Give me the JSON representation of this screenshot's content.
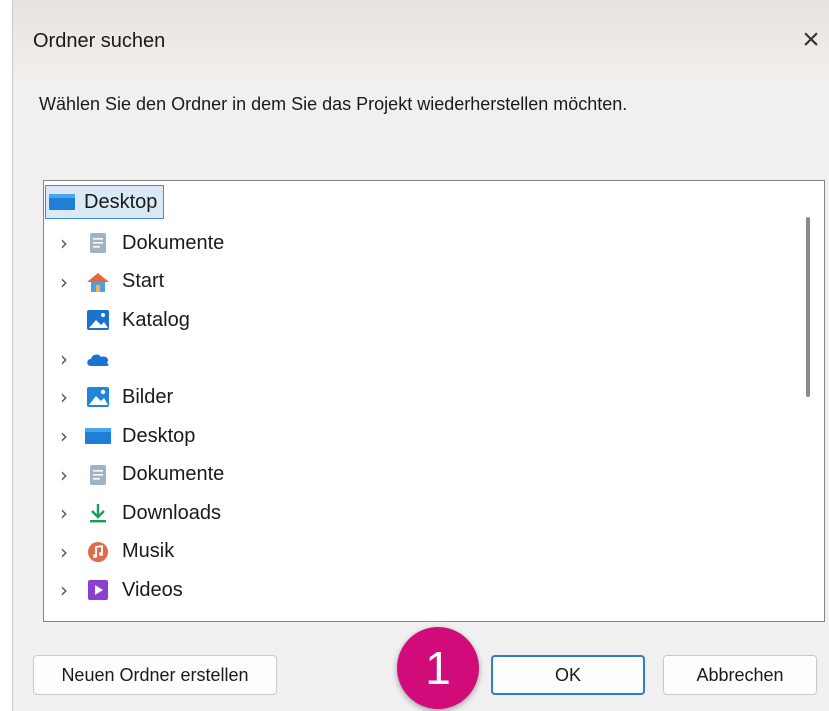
{
  "dialog": {
    "title": "Ordner suchen",
    "close_symbol": "×",
    "prompt": "Wählen Sie den Ordner in dem Sie das Projekt wiederherstellen möchten."
  },
  "tree": {
    "root": {
      "label": "Desktop",
      "icon": "desktop-folder-icon",
      "selected": true
    },
    "items": [
      {
        "label": "Dokumente",
        "icon": "documents-icon",
        "expandable": true
      },
      {
        "label": "Start",
        "icon": "home-icon",
        "expandable": true
      },
      {
        "label": "Katalog",
        "icon": "gallery-icon",
        "expandable": false
      },
      {
        "label": "",
        "icon": "onedrive-cloud-icon",
        "expandable": true
      },
      {
        "label": "Bilder",
        "icon": "pictures-icon",
        "expandable": true
      },
      {
        "label": "Desktop",
        "icon": "desktop-folder-icon",
        "expandable": true
      },
      {
        "label": "Dokumente",
        "icon": "documents-icon",
        "expandable": true
      },
      {
        "label": "Downloads",
        "icon": "downloads-icon",
        "expandable": true
      },
      {
        "label": "Musik",
        "icon": "music-icon",
        "expandable": true
      },
      {
        "label": "Videos",
        "icon": "videos-icon",
        "expandable": true
      }
    ],
    "chevron_symbol": "›"
  },
  "buttons": {
    "new_folder": "Neuen Ordner erstellen",
    "ok": "OK",
    "cancel": "Abbrechen"
  },
  "annotation": {
    "step_number": "1",
    "color": "#d10c7a"
  },
  "colors": {
    "selection_fill": "#dbe8f5",
    "selection_border": "#3c8fd8",
    "ok_border": "#2e7bd1"
  }
}
